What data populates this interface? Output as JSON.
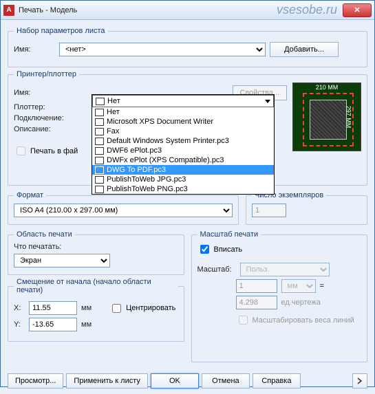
{
  "window": {
    "title": "Печать - Модель",
    "watermark": "vsesobe.ru",
    "appicon": "A"
  },
  "pageset": {
    "legend": "Набор параметров листа",
    "name_label": "Имя:",
    "name_value": "<нет>",
    "add_btn": "Добавить..."
  },
  "printer": {
    "legend": "Принтер/плоттер",
    "name_label": "Имя:",
    "plotter_label": "Плоттер:",
    "conn_label": "Подключение:",
    "desc_label": "Описание:",
    "props_btn": "Свойства...",
    "print_file_label": "Печать в фай",
    "preview_w": "210 MM",
    "preview_h": "297 MM",
    "dropdown_current": "Нет",
    "options": [
      "Нет",
      "Microsoft XPS Document Writer",
      "Fax",
      "Default Windows System Printer.pc3",
      "DWF6 ePlot.pc3",
      "DWFx ePlot (XPS Compatible).pc3",
      "DWG To PDF.pc3",
      "PublishToWeb JPG.pc3",
      "PublishToWeb PNG.pc3"
    ]
  },
  "format": {
    "legend": "Формат",
    "value": "ISO A4 (210.00 x 297.00 мм)"
  },
  "copies": {
    "legend": "Число экземпляров",
    "value": "1"
  },
  "area": {
    "legend": "Область печати",
    "what_label": "Что печатать:",
    "value": "Экран"
  },
  "scale": {
    "legend": "Масштаб печати",
    "fit_label": "Вписать",
    "scale_label": "Масштаб:",
    "scale_value": "Польз.",
    "units_top": "1",
    "units_sel": "мм",
    "eq": "=",
    "units_bottom": "4.298",
    "units_suffix": "ед.чертежа",
    "scale_lw": "Масштабировать веса линий"
  },
  "offset": {
    "legend": "Смещение от начала (начало области печати)",
    "x_label": "X:",
    "x_value": "11.55",
    "y_label": "Y:",
    "y_value": "-13.65",
    "mm": "мм",
    "center_label": "Центрировать"
  },
  "buttons": {
    "preview": "Просмотр...",
    "apply": "Применить к листу",
    "ok": "OK",
    "cancel": "Отмена",
    "help": "Справка"
  }
}
